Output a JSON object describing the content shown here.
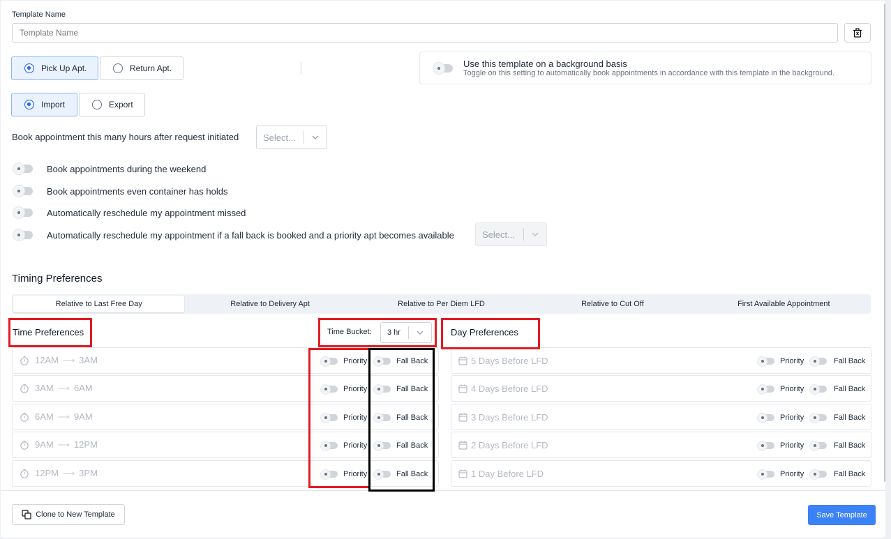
{
  "template_name": {
    "label": "Template Name",
    "placeholder": "Template Name"
  },
  "appointment_type": {
    "options": [
      "Pick Up Apt.",
      "Return Apt."
    ],
    "selected": "Pick Up Apt."
  },
  "direction": {
    "options": [
      "Import",
      "Export"
    ],
    "selected": "Import"
  },
  "background_basis": {
    "title": "Use this template on a background basis",
    "description": "Toggle on this setting to automatically book appointments in accordance with this template in the background."
  },
  "book_hours": {
    "label": "Book appointment this many hours after request initiated",
    "placeholder": "Select..."
  },
  "options": [
    "Book appointments during the weekend",
    "Book appointments even container has holds",
    "Automatically reschedule my appointment missed",
    "Automatically reschedule my appointment if a fall back is booked and a priority apt becomes available"
  ],
  "reschedule_select_placeholder": "Select...",
  "timing": {
    "title": "Timing Preferences",
    "tabs": [
      "Relative to Last Free Day",
      "Relative to Delivery Apt",
      "Relative to Per Diem LFD",
      "Relative to Cut Off",
      "First Available Appointment"
    ],
    "active_tab": "Relative to Last Free Day"
  },
  "time_preferences": {
    "title": "Time Preferences",
    "bucket_label": "Time Bucket:",
    "bucket_value": "3 hr",
    "rows": [
      {
        "from": "12AM",
        "to": "3AM"
      },
      {
        "from": "3AM",
        "to": "6AM"
      },
      {
        "from": "6AM",
        "to": "9AM"
      },
      {
        "from": "9AM",
        "to": "12PM"
      },
      {
        "from": "12PM",
        "to": "3PM"
      }
    ]
  },
  "day_preferences": {
    "title": "Day Preferences",
    "rows": [
      "5 Days Before LFD",
      "4 Days Before LFD",
      "3 Days Before LFD",
      "2 Days Before LFD",
      "1 Day Before LFD"
    ]
  },
  "toggle_labels": {
    "priority": "Priority",
    "fallback": "Fall Back"
  },
  "footer": {
    "clone_label": "Clone to New Template",
    "save_label": "Save Template"
  },
  "colors": {
    "primary": "#3b82f6",
    "highlight_red": "#e21c24",
    "highlight_black": "#000000"
  }
}
